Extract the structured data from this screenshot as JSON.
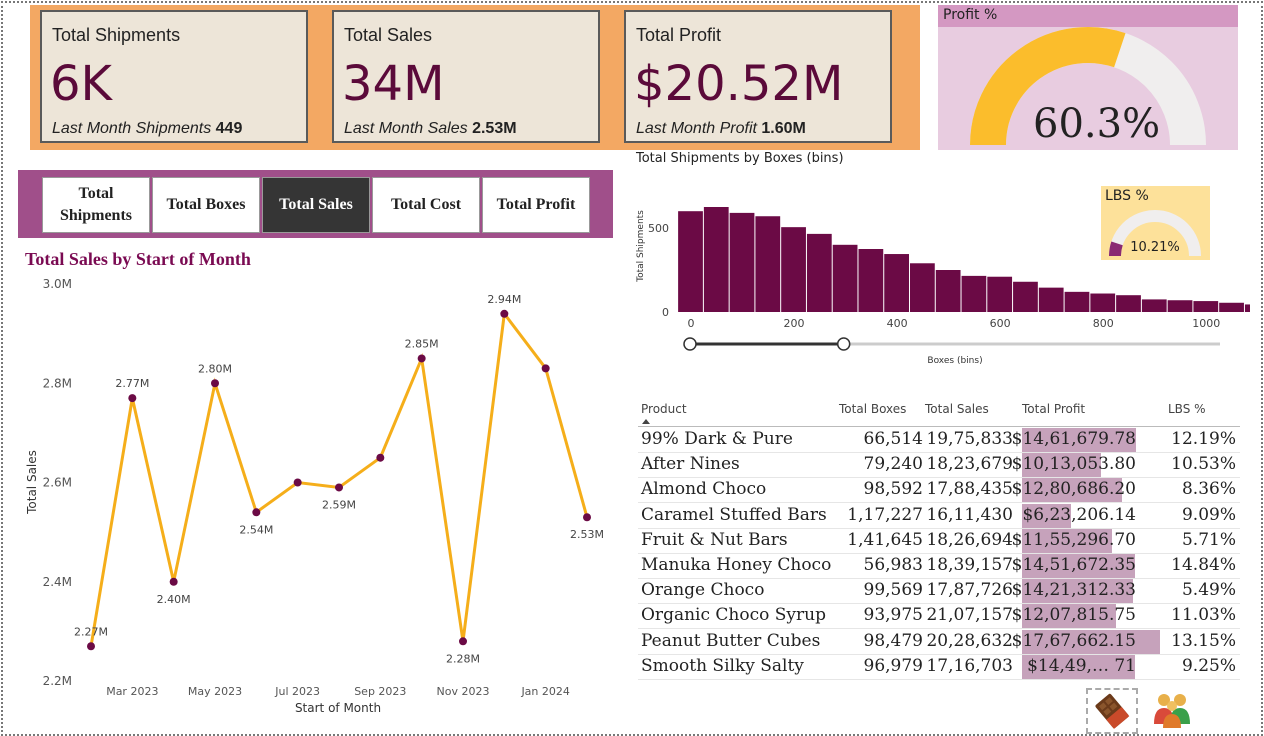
{
  "kpis": [
    {
      "title": "Total Shipments",
      "value": "6K",
      "sub_label": "Last Month Shipments",
      "sub_value": "449"
    },
    {
      "title": "Total Sales",
      "value": "34M",
      "sub_label": "Last Month Sales",
      "sub_value": "2.53M"
    },
    {
      "title": "Total Profit",
      "value": "$20.52M",
      "sub_label": "Last Month Profit",
      "sub_value": "1.60M"
    }
  ],
  "profit_gauge": {
    "title": "Profit %",
    "value": "60.3%",
    "fraction": 0.603,
    "fill_color": "#fbbd2c",
    "track_color": "#f0eeee"
  },
  "tabs": [
    {
      "label": "Total Shipments",
      "active": false
    },
    {
      "label": "Total Boxes",
      "active": false
    },
    {
      "label": "Total Sales",
      "active": true
    },
    {
      "label": "Total Cost",
      "active": false
    },
    {
      "label": "Total Profit",
      "active": false
    }
  ],
  "line_chart": {
    "title": "Total Sales by Start of Month",
    "chart_data": {
      "type": "line",
      "x": [
        "Feb 2023",
        "Mar 2023",
        "Apr 2023",
        "May 2023",
        "Jun 2023",
        "Jul 2023",
        "Aug 2023",
        "Sep 2023",
        "Oct 2023",
        "Nov 2023",
        "Dec 2023",
        "Jan 2024",
        "Feb 2024"
      ],
      "values": [
        2.27,
        2.77,
        2.4,
        2.8,
        2.54,
        2.6,
        2.59,
        2.65,
        2.85,
        2.28,
        2.94,
        2.83,
        2.53
      ],
      "data_labels": [
        "2.27M",
        "2.77M",
        "2.40M",
        "2.80M",
        "2.54M",
        "",
        "2.59M",
        "",
        "2.85M",
        "2.28M",
        "2.94M",
        "",
        "2.53M"
      ],
      "x_ticks": [
        "Mar 2023",
        "May 2023",
        "Jul 2023",
        "Sep 2023",
        "Nov 2023",
        "Jan 2024"
      ],
      "y_ticks": [
        "2.2M",
        "2.4M",
        "2.6M",
        "2.8M",
        "3.0M"
      ],
      "xlabel": "Start of Month",
      "ylabel": "Total Sales",
      "ylim": [
        2.2,
        3.0
      ],
      "line_color": "#f5ae1a",
      "marker_color": "#6b0a45",
      "grid": false
    }
  },
  "histogram": {
    "title": "Total Shipments by Boxes (bins)",
    "chart_data": {
      "type": "bar",
      "bin_width": 50,
      "x_start": -25,
      "values": [
        600,
        625,
        590,
        570,
        505,
        465,
        400,
        375,
        345,
        290,
        250,
        215,
        210,
        180,
        145,
        120,
        110,
        100,
        75,
        70,
        65,
        55,
        45
      ],
      "x_ticks": [
        "0",
        "200",
        "400",
        "600",
        "800",
        "1000"
      ],
      "y_ticks": [
        "0",
        "500"
      ],
      "xlabel": "Boxes (bins)",
      "ylabel": "Total Shipments",
      "ylim": [
        0,
        700
      ],
      "bar_color": "#6b0a45",
      "grid": false
    },
    "slider": {
      "from_fraction": 0.0,
      "to_fraction": 0.29
    }
  },
  "lbs_gauge": {
    "title": "LBS %",
    "value": "10.21%",
    "fraction": 0.1021,
    "fill_color": "#8a2a72",
    "track_color": "#f0eeee"
  },
  "table": {
    "headers": [
      "Product",
      "Total Boxes",
      "Total Sales",
      "Total Profit",
      "LBS %"
    ],
    "rows": [
      {
        "product": "99% Dark & Pure",
        "boxes": "66,514",
        "sales": "19,75,833",
        "profit": "$14,61,679.78",
        "profit_value": 1461679.78,
        "lbs": "12.19%"
      },
      {
        "product": "After Nines",
        "boxes": "79,240",
        "sales": "18,23,679",
        "profit": "$10,13,053.80",
        "profit_value": 1013053.8,
        "lbs": "10.53%"
      },
      {
        "product": "Almond Choco",
        "boxes": "98,592",
        "sales": "17,88,435",
        "profit": "$12,80,686.20",
        "profit_value": 1280686.2,
        "lbs": "8.36%"
      },
      {
        "product": "Caramel Stuffed Bars",
        "boxes": "1,17,227",
        "sales": "16,11,430",
        "profit": "$6,23,206.14",
        "profit_value": 623206.14,
        "lbs": "9.09%"
      },
      {
        "product": "Fruit & Nut Bars",
        "boxes": "1,41,645",
        "sales": "18,26,694",
        "profit": "$11,55,296.70",
        "profit_value": 1155296.7,
        "lbs": "5.71%"
      },
      {
        "product": "Manuka Honey Choco",
        "boxes": "56,983",
        "sales": "18,39,157",
        "profit": "$14,51,672.35",
        "profit_value": 1451672.35,
        "lbs": "14.84%"
      },
      {
        "product": "Orange Choco",
        "boxes": "99,569",
        "sales": "17,87,726",
        "profit": "$14,21,312.33",
        "profit_value": 1421312.33,
        "lbs": "5.49%"
      },
      {
        "product": "Organic Choco Syrup",
        "boxes": "93,975",
        "sales": "21,07,157",
        "profit": "$12,07,815.75",
        "profit_value": 1207815.75,
        "lbs": "11.03%"
      },
      {
        "product": "Peanut Butter Cubes",
        "boxes": "98,479",
        "sales": "20,28,632",
        "profit": "$17,67,662.15",
        "profit_value": 1767662.15,
        "lbs": "13.15%"
      },
      {
        "product": "Smooth Silky Salty",
        "boxes": "96,979",
        "sales": "17,16,703",
        "profit": "$14,49,… 71",
        "profit_value": 1449000,
        "lbs": "9.25%"
      }
    ],
    "profit_max": 1767662.15,
    "bar_color": "#c6a2bb"
  },
  "icons": {
    "left": "chocolate-bar-icon",
    "right": "people-group-icon"
  }
}
